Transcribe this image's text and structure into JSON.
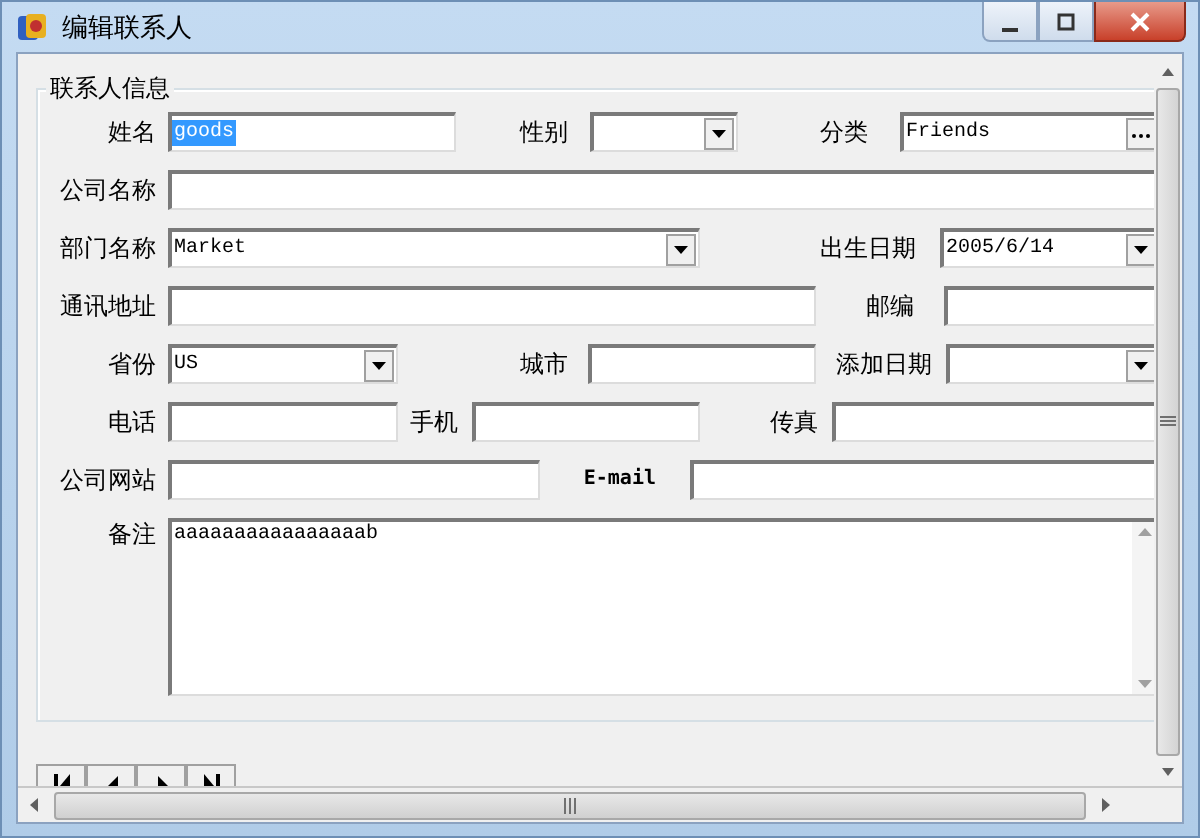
{
  "window": {
    "title": "编辑联系人"
  },
  "group": {
    "title": "联系人信息"
  },
  "fields": [
    {
      "label": "姓名",
      "kind": "text",
      "value": "goods",
      "highlighted": true
    },
    {
      "label": "性别",
      "kind": "combo"
    },
    {
      "label": "分类",
      "kind": "picker",
      "value": "Friends"
    },
    {
      "label": "公司名称",
      "kind": "text"
    },
    {
      "label": "部门名称",
      "kind": "combo",
      "value": "Market"
    },
    {
      "label": "出生日期",
      "kind": "combo",
      "value": "2005/6/14"
    },
    {
      "label": "通讯地址",
      "kind": "text"
    },
    {
      "label": "邮编",
      "kind": "text"
    },
    {
      "label": "省份",
      "kind": "combo",
      "value": "US"
    },
    {
      "label": "城市",
      "kind": "text"
    },
    {
      "label": "添加日期",
      "kind": "combo"
    },
    {
      "label": "电话",
      "kind": "text"
    },
    {
      "label": "手机",
      "kind": "text"
    },
    {
      "label": "传真",
      "kind": "text"
    },
    {
      "label": "公司网站",
      "kind": "text"
    },
    {
      "label": "E-mail",
      "kind": "text"
    },
    {
      "label": "备注",
      "kind": "memo",
      "value": "aaaaaaaaaaaaaaaab"
    }
  ]
}
